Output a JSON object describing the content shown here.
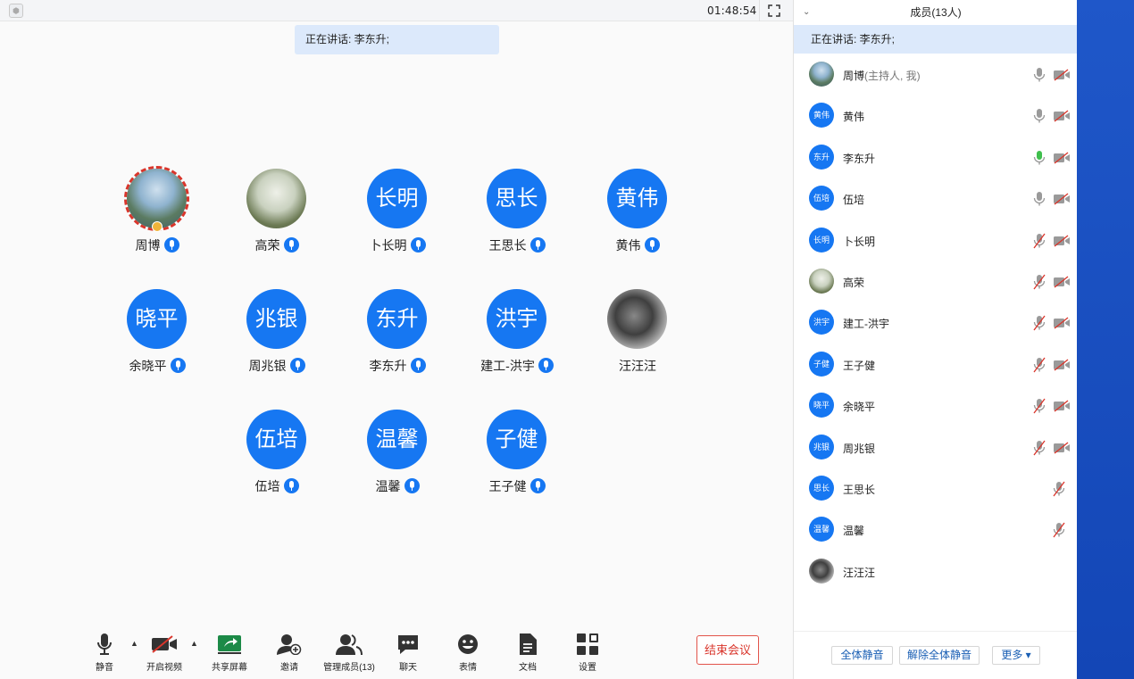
{
  "topbar": {
    "timer": "01:48:54"
  },
  "speaking_banner": "正在讲话: 李东升;",
  "tiles": [
    {
      "name": "周博",
      "avatar_text": "",
      "photo": "photo1",
      "host": true
    },
    {
      "name": "高荣",
      "avatar_text": "",
      "photo": "photo2",
      "host": false
    },
    {
      "name": "卜长明",
      "avatar_text": "长明"
    },
    {
      "name": "王思长",
      "avatar_text": "思长"
    },
    {
      "name": "黄伟",
      "avatar_text": "黄伟"
    },
    {
      "name": "余晓平",
      "avatar_text": "晓平"
    },
    {
      "name": "周兆银",
      "avatar_text": "兆银"
    },
    {
      "name": "李东升",
      "avatar_text": "东升"
    },
    {
      "name": "建工-洪宇",
      "avatar_text": "洪宇"
    },
    {
      "name": "汪汪汪",
      "avatar_text": "",
      "photo": "photo3",
      "nomic": true
    },
    {
      "name": "伍培",
      "avatar_text": "伍培"
    },
    {
      "name": "温馨",
      "avatar_text": "温馨"
    },
    {
      "name": "王子健",
      "avatar_text": "子健"
    }
  ],
  "toolbar": {
    "mute": "静音",
    "video": "开启视频",
    "share": "共享屏幕",
    "invite": "邀请",
    "manage": "管理成员(13)",
    "chat": "聊天",
    "emoji": "表情",
    "docs": "文档",
    "settings": "设置",
    "end": "结束会议"
  },
  "panel": {
    "title": "成员(13人)",
    "speaking": "正在讲话: 李东升;",
    "members": [
      {
        "name": "周博",
        "sub": "(主持人, 我)",
        "avatar": "",
        "photo": "photo1",
        "mic": "on",
        "cam": "off"
      },
      {
        "name": "黄伟",
        "avatar": "黄伟",
        "mic": "on",
        "cam": "off"
      },
      {
        "name": "李东升",
        "avatar": "东升",
        "mic": "speaking",
        "cam": "off"
      },
      {
        "name": "伍培",
        "avatar": "伍培",
        "mic": "on",
        "cam": "off"
      },
      {
        "name": "卜长明",
        "avatar": "长明",
        "mic": "muted",
        "cam": "off"
      },
      {
        "name": "高荣",
        "avatar": "",
        "photo": "photo2",
        "mic": "muted",
        "cam": "off"
      },
      {
        "name": "建工-洪宇",
        "avatar": "洪宇",
        "mic": "muted",
        "cam": "off"
      },
      {
        "name": "王子健",
        "avatar": "子健",
        "mic": "muted",
        "cam": "off"
      },
      {
        "name": "余晓平",
        "avatar": "晓平",
        "mic": "muted",
        "cam": "off"
      },
      {
        "name": "周兆银",
        "avatar": "兆银",
        "mic": "muted",
        "cam": "off"
      },
      {
        "name": "王思长",
        "avatar": "思长",
        "mic": "muted",
        "cam": "none"
      },
      {
        "name": "温馨",
        "avatar": "温馨",
        "mic": "muted",
        "cam": "none"
      },
      {
        "name": "汪汪汪",
        "avatar": "",
        "photo": "photo3",
        "mic": "none",
        "cam": "none"
      }
    ],
    "buttons": {
      "mute_all": "全体静音",
      "unmute_all": "解除全体静音",
      "more": "更多 ▾"
    }
  },
  "colors": {
    "accent": "#1677f2",
    "speaking_bg": "#dce9fb",
    "end_red": "#d9352b",
    "taskbar": "#1346b6"
  }
}
